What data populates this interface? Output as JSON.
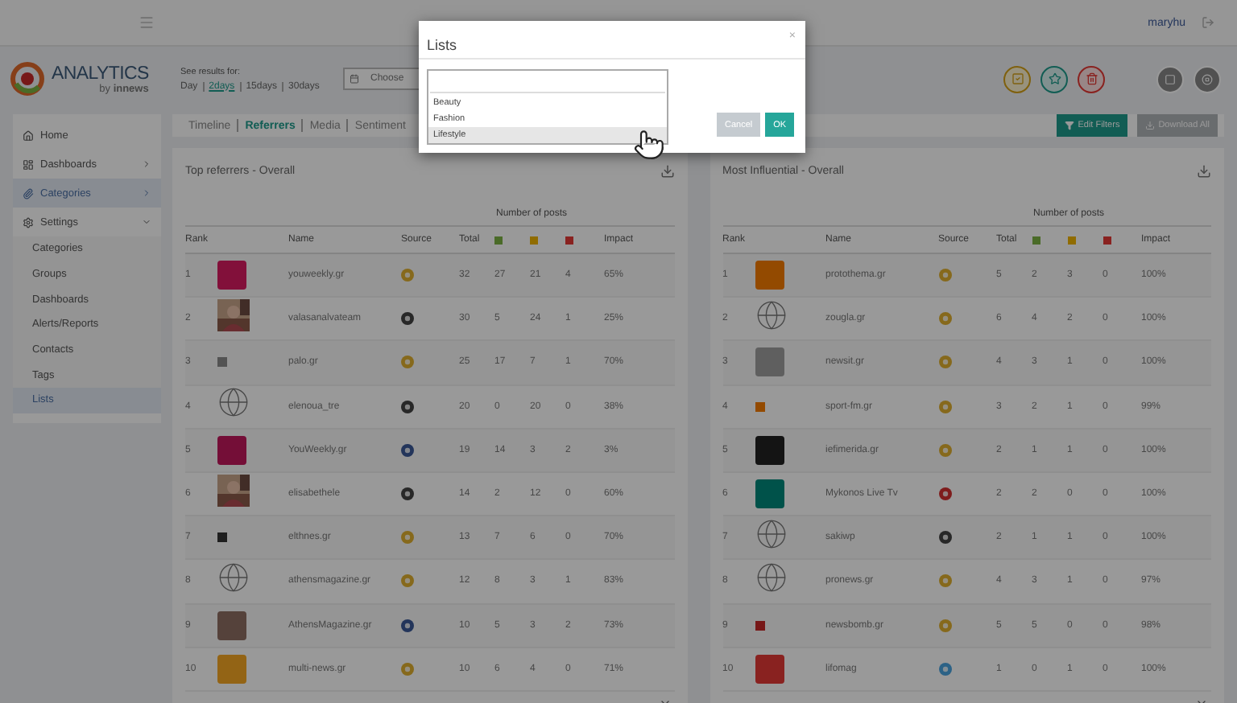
{
  "topbar": {
    "username": "maryhu"
  },
  "logo": {
    "name": "ANALYTICS",
    "byline_prefix": "by",
    "byline_brand": "innews"
  },
  "results": {
    "label": "See results for:",
    "ranges": [
      {
        "label": "Day",
        "selected": false
      },
      {
        "label": "2days",
        "selected": true
      },
      {
        "label": "15days",
        "selected": false
      },
      {
        "label": "30days",
        "selected": false
      }
    ],
    "date_placeholder": "Choose"
  },
  "sidebar": {
    "items": [
      {
        "label": "Home",
        "selected": false
      },
      {
        "label": "Dashboards",
        "expandable": true,
        "expanded": false,
        "selected": false
      },
      {
        "label": "Categories",
        "expandable": true,
        "expanded": false,
        "selected": true
      },
      {
        "label": "Settings",
        "expandable": true,
        "expanded": true,
        "selected": false,
        "children": [
          {
            "label": "Categories",
            "selected": false
          },
          {
            "label": "Groups",
            "selected": false
          },
          {
            "label": "Dashboards",
            "selected": false
          },
          {
            "label": "Alerts/Reports",
            "selected": false
          },
          {
            "label": "Contacts",
            "selected": false
          },
          {
            "label": "Tags",
            "selected": false
          },
          {
            "label": "Lists",
            "selected": true
          }
        ]
      }
    ]
  },
  "tabs": [
    {
      "label": "Timeline",
      "selected": false
    },
    {
      "label": "Referrers",
      "selected": true
    },
    {
      "label": "Media",
      "selected": false
    },
    {
      "label": "Sentiment",
      "selected": false
    }
  ],
  "actions": {
    "edit_filters": "Edit Filters",
    "download_all": "Download All"
  },
  "tables": [
    {
      "title": "Top referrers - Overall",
      "group_header": "Number of posts",
      "columns": [
        {
          "kind": "text",
          "label": "Rank"
        },
        {
          "kind": "blank"
        },
        {
          "kind": "text",
          "label": "Name"
        },
        {
          "kind": "text",
          "label": "Source"
        },
        {
          "kind": "text",
          "label": "Total"
        },
        {
          "kind": "swatch",
          "color": "#4a6b28"
        },
        {
          "kind": "swatch",
          "color": "#906c00"
        },
        {
          "kind": "swatch",
          "color": "#892220"
        },
        {
          "kind": "text",
          "label": "Impact"
        }
      ],
      "rows": [
        {
          "rank": "1",
          "logo": {
            "kind": "tile",
            "color": "#82103a"
          },
          "name": "youweekly.gr",
          "source": {
            "kind": "web"
          },
          "total": "32",
          "counts": [
            "27",
            "21",
            "4"
          ],
          "impact": "65%"
        },
        {
          "rank": "2",
          "logo": {
            "kind": "avatar"
          },
          "name": "valasanalvateam",
          "source": {
            "kind": "instagram"
          },
          "total": "30",
          "counts": [
            "5",
            "24",
            "1"
          ],
          "impact": "25%"
        },
        {
          "rank": "3",
          "logo": {
            "kind": "glyph",
            "color": "#535353"
          },
          "name": "palo.gr",
          "source": {
            "kind": "web"
          },
          "total": "25",
          "counts": [
            "17",
            "7",
            "1"
          ],
          "impact": "70%"
        },
        {
          "rank": "4",
          "logo": {
            "kind": "globe"
          },
          "name": "elenoua_tre",
          "source": {
            "kind": "instagram"
          },
          "total": "20",
          "counts": [
            "0",
            "20",
            "0"
          ],
          "impact": "38%"
        },
        {
          "rank": "5",
          "logo": {
            "kind": "tile",
            "color": "#740e37"
          },
          "name": "YouWeekly.gr",
          "source": {
            "kind": "facebook"
          },
          "total": "19",
          "counts": [
            "14",
            "3",
            "2"
          ],
          "impact": "3%"
        },
        {
          "rank": "6",
          "logo": {
            "kind": "avatar"
          },
          "name": "elisabethele",
          "source": {
            "kind": "instagram"
          },
          "total": "14",
          "counts": [
            "2",
            "12",
            "0"
          ],
          "impact": "60%"
        },
        {
          "rank": "7",
          "logo": {
            "kind": "glyph",
            "color": "#1f1f1f"
          },
          "name": "elthnes.gr",
          "source": {
            "kind": "web"
          },
          "total": "13",
          "counts": [
            "7",
            "6",
            "0"
          ],
          "impact": "70%"
        },
        {
          "rank": "8",
          "logo": {
            "kind": "globe"
          },
          "name": "athensmagazine.gr",
          "source": {
            "kind": "web"
          },
          "total": "12",
          "counts": [
            "8",
            "3",
            "1"
          ],
          "impact": "83%"
        },
        {
          "rank": "9",
          "logo": {
            "kind": "tile",
            "color": "#55423b"
          },
          "name": "AthensMagazine.gr",
          "source": {
            "kind": "facebook"
          },
          "total": "10",
          "counts": [
            "5",
            "3",
            "2"
          ],
          "impact": "73%"
        },
        {
          "rank": "10",
          "logo": {
            "kind": "tile",
            "color": "#936415"
          },
          "name": "multi-news.gr",
          "source": {
            "kind": "web"
          },
          "total": "10",
          "counts": [
            "6",
            "4",
            "0"
          ],
          "impact": "71%"
        }
      ]
    },
    {
      "title": "Most Influential - Overall",
      "group_header": "Number of posts",
      "columns": [
        {
          "kind": "text",
          "label": "Rank"
        },
        {
          "kind": "blank"
        },
        {
          "kind": "text",
          "label": "Name"
        },
        {
          "kind": "text",
          "label": "Source"
        },
        {
          "kind": "text",
          "label": "Total"
        },
        {
          "kind": "swatch",
          "color": "#4a6b28"
        },
        {
          "kind": "swatch",
          "color": "#906c00"
        },
        {
          "kind": "swatch",
          "color": "#892220"
        },
        {
          "kind": "text",
          "label": "Impact"
        }
      ],
      "rows": [
        {
          "rank": "1",
          "logo": {
            "kind": "tile",
            "color": "#934a00"
          },
          "name": "protothema.gr",
          "source": {
            "kind": "web"
          },
          "total": "5",
          "counts": [
            "2",
            "3",
            "0"
          ],
          "impact": "100%"
        },
        {
          "rank": "2",
          "logo": {
            "kind": "globe"
          },
          "name": "zougla.gr",
          "source": {
            "kind": "web"
          },
          "total": "6",
          "counts": [
            "4",
            "2",
            "0"
          ],
          "impact": "100%"
        },
        {
          "rank": "3",
          "logo": {
            "kind": "tile",
            "color": "#5f5f5f"
          },
          "name": "newsit.gr",
          "source": {
            "kind": "web"
          },
          "total": "4",
          "counts": [
            "3",
            "1",
            "0"
          ],
          "impact": "100%"
        },
        {
          "rank": "4",
          "logo": {
            "kind": "glyph",
            "color": "#934a00"
          },
          "name": "sport-fm.gr",
          "source": {
            "kind": "web"
          },
          "total": "3",
          "counts": [
            "2",
            "1",
            "0"
          ],
          "impact": "99%"
        },
        {
          "rank": "5",
          "logo": {
            "kind": "tile",
            "color": "#141414"
          },
          "name": "iefimerida.gr",
          "source": {
            "kind": "web"
          },
          "total": "2",
          "counts": [
            "1",
            "1",
            "0"
          ],
          "impact": "100%"
        },
        {
          "rank": "6",
          "logo": {
            "kind": "tile",
            "color": "#00524a"
          },
          "name": "Mykonos Live Tv",
          "source": {
            "kind": "youtube"
          },
          "total": "2",
          "counts": [
            "2",
            "0",
            "0"
          ],
          "impact": "100%"
        },
        {
          "rank": "7",
          "logo": {
            "kind": "globe"
          },
          "name": "sakiwp",
          "source": {
            "kind": "instagram"
          },
          "total": "2",
          "counts": [
            "1",
            "1",
            "0"
          ],
          "impact": "100%"
        },
        {
          "rank": "8",
          "logo": {
            "kind": "globe"
          },
          "name": "pronews.gr",
          "source": {
            "kind": "web"
          },
          "total": "4",
          "counts": [
            "3",
            "1",
            "0"
          ],
          "impact": "97%"
        },
        {
          "rank": "9",
          "logo": {
            "kind": "glyph",
            "color": "#771818"
          },
          "name": "newsbomb.gr",
          "source": {
            "kind": "web"
          },
          "total": "5",
          "counts": [
            "5",
            "0",
            "0"
          ],
          "impact": "98%"
        },
        {
          "rank": "10",
          "logo": {
            "kind": "tile",
            "color": "#892220"
          },
          "name": "lifomag",
          "source": {
            "kind": "twitter"
          },
          "total": "1",
          "counts": [
            "0",
            "1",
            "0"
          ],
          "impact": "100%"
        }
      ]
    }
  ],
  "modal": {
    "title": "Lists",
    "close": "×",
    "options": [
      {
        "label": "Beauty",
        "selected": false
      },
      {
        "label": "Fashion",
        "selected": false
      },
      {
        "label": "Lifestyle",
        "selected": true
      }
    ],
    "buttons": [
      {
        "kind": "cancel",
        "label": "Cancel"
      },
      {
        "kind": "ok",
        "label": "OK"
      }
    ]
  }
}
